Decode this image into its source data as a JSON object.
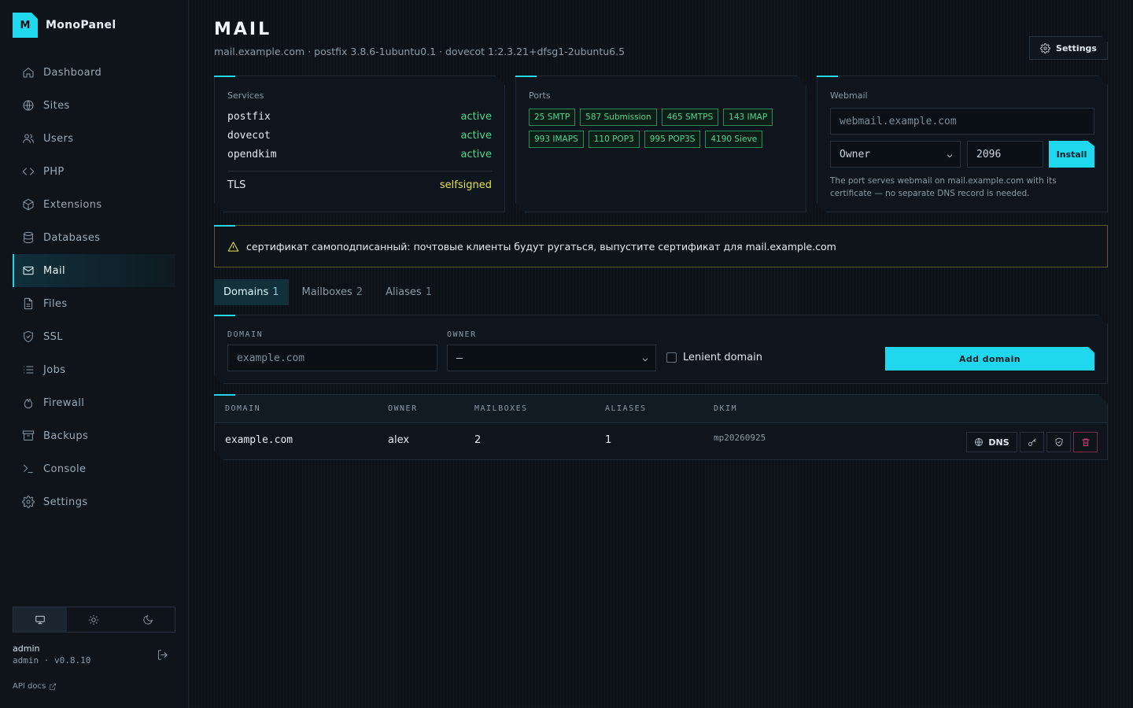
{
  "app": {
    "logo_letter": "M",
    "name": "MonoPanel"
  },
  "nav": [
    {
      "label": "Dashboard",
      "icon": "home-icon"
    },
    {
      "label": "Sites",
      "icon": "globe-icon"
    },
    {
      "label": "Users",
      "icon": "users-icon"
    },
    {
      "label": "PHP",
      "icon": "code-icon"
    },
    {
      "label": "Extensions",
      "icon": "package-icon"
    },
    {
      "label": "Databases",
      "icon": "database-icon"
    },
    {
      "label": "Mail",
      "icon": "mail-icon",
      "active": true
    },
    {
      "label": "Files",
      "icon": "file-icon"
    },
    {
      "label": "SSL",
      "icon": "shield-icon"
    },
    {
      "label": "Jobs",
      "icon": "list-icon"
    },
    {
      "label": "Firewall",
      "icon": "flame-icon"
    },
    {
      "label": "Backups",
      "icon": "archive-icon"
    },
    {
      "label": "Console",
      "icon": "terminal-icon"
    },
    {
      "label": "Settings",
      "icon": "gear-icon"
    }
  ],
  "theme": {
    "selected": "system"
  },
  "user": {
    "name": "admin",
    "meta": "admin · v0.8.10"
  },
  "api_docs": "API docs",
  "header": {
    "title": "MAIL",
    "subtitle": "mail.example.com · postfix 3.8.6-1ubuntu0.1 · dovecot 1:2.3.21+dfsg1-2ubuntu6.5",
    "settings_label": "Settings"
  },
  "services": {
    "label": "Services",
    "rows": [
      {
        "name": "postfix",
        "status": "active"
      },
      {
        "name": "dovecot",
        "status": "active"
      },
      {
        "name": "opendkim",
        "status": "active"
      }
    ],
    "tls_label": "TLS",
    "tls_status": "selfsigned"
  },
  "ports": {
    "label": "Ports",
    "chips": [
      "25 SMTP",
      "587 Submission",
      "465 SMTPS",
      "143 IMAP",
      "993 IMAPS",
      "110 POP3",
      "995 POP3S",
      "4190 Sieve"
    ]
  },
  "webmail": {
    "label": "Webmail",
    "host_placeholder": "webmail.example.com",
    "owner_value": "Owner",
    "port_value": "2096",
    "install_label": "Install",
    "note": "The port serves webmail on mail.example.com with its certificate — no separate DNS record is needed."
  },
  "warning": {
    "text": "сертификат самоподписанный: почтовые клиенты будут ругаться, выпустите сертификат для mail.example.com"
  },
  "tabs": [
    {
      "label": "Domains",
      "count": "1",
      "active": true
    },
    {
      "label": "Mailboxes",
      "count": "2"
    },
    {
      "label": "Aliases",
      "count": "1"
    }
  ],
  "add_form": {
    "domain_label": "DOMAIN",
    "domain_placeholder": "example.com",
    "owner_label": "OWNER",
    "owner_value": "—",
    "lenient_label": "Lenient domain",
    "lenient_checked": false,
    "add_label": "Add domain"
  },
  "table": {
    "headers": [
      "DOMAIN",
      "OWNER",
      "MAILBOXES",
      "ALIASES",
      "DKIM"
    ],
    "rows": [
      {
        "domain": "example.com",
        "owner": "alex",
        "mailboxes": "2",
        "aliases": "1",
        "dkim": "mp20260925",
        "dns_label": "DNS"
      }
    ]
  },
  "colors": {
    "accent": "#1fd8ee",
    "status_ok": "#4fd88f",
    "status_warn": "#e3e24f",
    "danger": "#f24d8d"
  }
}
